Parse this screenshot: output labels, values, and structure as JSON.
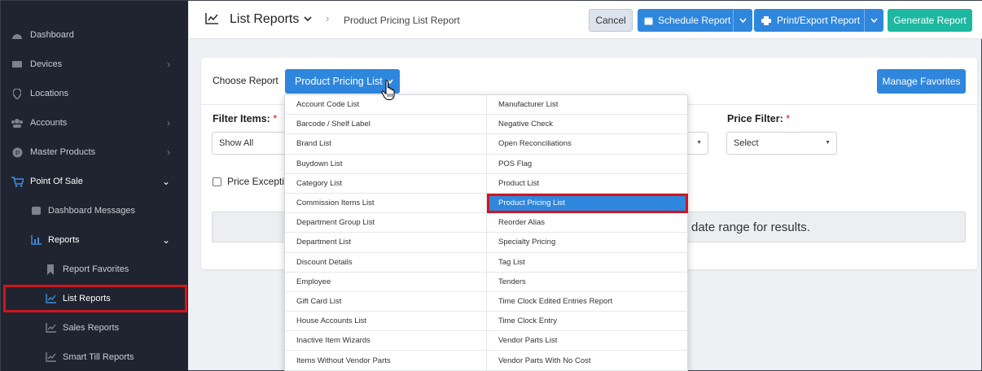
{
  "sidebar": {
    "items": [
      {
        "label": "Dashboard",
        "icon": "dashboard-icon"
      },
      {
        "label": "Devices",
        "icon": "devices-icon",
        "chevron": "›"
      },
      {
        "label": "Locations",
        "icon": "location-pin-icon"
      },
      {
        "label": "Accounts",
        "icon": "users-icon",
        "chevron": "›"
      },
      {
        "label": "Master Products",
        "icon": "product-icon",
        "chevron": "›"
      },
      {
        "label": "Point Of Sale",
        "icon": "cart-icon",
        "chevron": "⌄"
      },
      {
        "label": "Dashboard Messages",
        "icon": "message-icon"
      },
      {
        "label": "Reports",
        "icon": "bar-chart-icon",
        "chevron": "⌄"
      },
      {
        "label": "Report Favorites",
        "icon": "bookmark-icon"
      },
      {
        "label": "List Reports",
        "icon": "line-chart-icon"
      },
      {
        "label": "Sales Reports",
        "icon": "line-chart-icon"
      },
      {
        "label": "Smart Till Reports",
        "icon": "line-chart-icon"
      }
    ]
  },
  "header": {
    "title": "List Reports",
    "breadcrumb": "Product Pricing List Report",
    "cancel_label": "Cancel",
    "schedule_label": "Schedule Report",
    "print_label": "Print/Export Report",
    "generate_label": "Generate Report"
  },
  "form": {
    "choose_label": "Choose Report",
    "selected_report": "Product Pricing List",
    "manage_label": "Manage Favorites",
    "filter_label": "Filter Items:",
    "filter_value": "Show All",
    "price_label": "Price Filter:",
    "price_value": "Select",
    "checkbox_label": "Price Exceptio",
    "required_mark": "*",
    "message": "date range for results."
  },
  "dropdown": {
    "left": [
      "Account Code List",
      "Barcode / Shelf Label",
      "Brand List",
      "Buydown List",
      "Category List",
      "Commission Items List",
      "Department Group List",
      "Department List",
      "Discount Details",
      "Employee",
      "Gift Card List",
      "House Accounts List",
      "Inactive Item Wizards",
      "Items Without Vendor Parts"
    ],
    "right": [
      "Manufacturer List",
      "Negative Check",
      "Open Reconciliations",
      "POS Flag",
      "Product List",
      "Product Pricing List",
      "Reorder Alias",
      "Specialty Pricing",
      "Tag List",
      "Tenders",
      "Time Clock Edited Entries Report",
      "Time Clock Entry",
      "Vendor Parts List",
      "Vendor Parts With No Cost"
    ],
    "selected": "Product Pricing List"
  },
  "colors": {
    "sidebar_bg": "#1f2430",
    "primary": "#2f86dd",
    "accent_green": "#1cb89f",
    "highlight_red": "#d0161e"
  }
}
